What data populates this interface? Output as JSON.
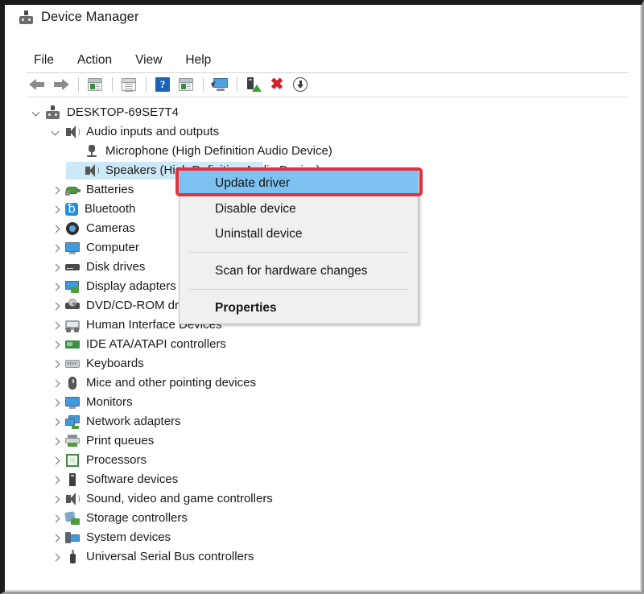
{
  "window": {
    "title": "Device Manager",
    "title_icon": "device-manager-icon"
  },
  "menubar": {
    "items": [
      {
        "label": "File",
        "name": "menu-file"
      },
      {
        "label": "Action",
        "name": "menu-action"
      },
      {
        "label": "View",
        "name": "menu-view"
      },
      {
        "label": "Help",
        "name": "menu-help"
      }
    ]
  },
  "toolbar": {
    "buttons": [
      {
        "icon": "back-arrow-icon",
        "name": "toolbar-back"
      },
      {
        "icon": "forward-arrow-icon",
        "name": "toolbar-forward"
      },
      {
        "icon": "show-hide-console-tree-icon",
        "name": "toolbar-console-tree"
      },
      {
        "icon": "properties-icon",
        "name": "toolbar-properties"
      },
      {
        "icon": "help-icon",
        "name": "toolbar-help"
      },
      {
        "icon": "show-hide-action-pane-icon",
        "name": "toolbar-action-pane"
      },
      {
        "icon": "scan-for-hardware-changes-icon",
        "name": "toolbar-scan-hardware"
      },
      {
        "icon": "update-driver-icon",
        "name": "toolbar-update-driver"
      },
      {
        "icon": "uninstall-device-icon",
        "name": "toolbar-uninstall-device"
      },
      {
        "icon": "disable-device-icon",
        "name": "toolbar-disable-device"
      }
    ]
  },
  "tree": {
    "root": {
      "label": "DESKTOP-69SE7T4",
      "icon": "computer-icon",
      "expanded": true
    },
    "nodes": [
      {
        "label": "Audio inputs and outputs",
        "icon": "speaker-icon",
        "level": 1,
        "expanded": true,
        "selected": false
      },
      {
        "label": "Microphone (High Definition Audio Device)",
        "icon": "microphone-icon",
        "level": 2,
        "expanded": null,
        "selected": false
      },
      {
        "label": "Speakers (High Definition Audio Device)",
        "icon": "speaker-icon",
        "level": 2,
        "expanded": null,
        "selected": true
      },
      {
        "label": "Batteries",
        "icon": "battery-icon",
        "level": 1,
        "expanded": false,
        "selected": false
      },
      {
        "label": "Bluetooth",
        "icon": "bluetooth-icon",
        "level": 1,
        "expanded": false,
        "selected": false
      },
      {
        "label": "Cameras",
        "icon": "camera-icon",
        "level": 1,
        "expanded": false,
        "selected": false
      },
      {
        "label": "Computer",
        "icon": "monitor-icon",
        "level": 1,
        "expanded": false,
        "selected": false
      },
      {
        "label": "Disk drives",
        "icon": "disk-drive-icon",
        "level": 1,
        "expanded": false,
        "selected": false
      },
      {
        "label": "Display adapters",
        "icon": "display-adapter-icon",
        "level": 1,
        "expanded": false,
        "selected": false
      },
      {
        "label": "DVD/CD-ROM drives",
        "icon": "dvd-drive-icon",
        "level": 1,
        "expanded": false,
        "selected": false
      },
      {
        "label": "Human Interface Devices",
        "icon": "hid-icon",
        "level": 1,
        "expanded": false,
        "selected": false
      },
      {
        "label": "IDE ATA/ATAPI controllers",
        "icon": "ide-controller-icon",
        "level": 1,
        "expanded": false,
        "selected": false
      },
      {
        "label": "Keyboards",
        "icon": "keyboard-icon",
        "level": 1,
        "expanded": false,
        "selected": false
      },
      {
        "label": "Mice and other pointing devices",
        "icon": "mouse-icon",
        "level": 1,
        "expanded": false,
        "selected": false
      },
      {
        "label": "Monitors",
        "icon": "monitor-icon",
        "level": 1,
        "expanded": false,
        "selected": false
      },
      {
        "label": "Network adapters",
        "icon": "network-adapter-icon",
        "level": 1,
        "expanded": false,
        "selected": false
      },
      {
        "label": "Print queues",
        "icon": "printer-icon",
        "level": 1,
        "expanded": false,
        "selected": false
      },
      {
        "label": "Processors",
        "icon": "processor-icon",
        "level": 1,
        "expanded": false,
        "selected": false
      },
      {
        "label": "Software devices",
        "icon": "software-device-icon",
        "level": 1,
        "expanded": false,
        "selected": false
      },
      {
        "label": "Sound, video and game controllers",
        "icon": "speaker-icon",
        "level": 1,
        "expanded": false,
        "selected": false
      },
      {
        "label": "Storage controllers",
        "icon": "storage-controller-icon",
        "level": 1,
        "expanded": false,
        "selected": false
      },
      {
        "label": "System devices",
        "icon": "system-device-icon",
        "level": 1,
        "expanded": false,
        "selected": false
      },
      {
        "label": "Universal Serial Bus controllers",
        "icon": "usb-controller-icon",
        "level": 1,
        "expanded": false,
        "selected": false
      }
    ]
  },
  "context_menu": {
    "items": [
      {
        "label": "Update driver",
        "highlighted": true,
        "bold": false
      },
      {
        "label": "Disable device",
        "highlighted": false,
        "bold": false
      },
      {
        "label": "Uninstall device",
        "highlighted": false,
        "bold": false
      },
      {
        "label": "Scan for hardware changes",
        "highlighted": false,
        "bold": false
      },
      {
        "label": "Properties",
        "highlighted": false,
        "bold": true
      }
    ]
  },
  "annotation": {
    "highlight_target": "Update driver",
    "box_color": "#e23241"
  },
  "colors": {
    "selection_blue": "#7cc2f0",
    "tree_selection": "#cde8f7",
    "menu_background": "#f0f0f0",
    "annotation_red": "#e23241"
  }
}
